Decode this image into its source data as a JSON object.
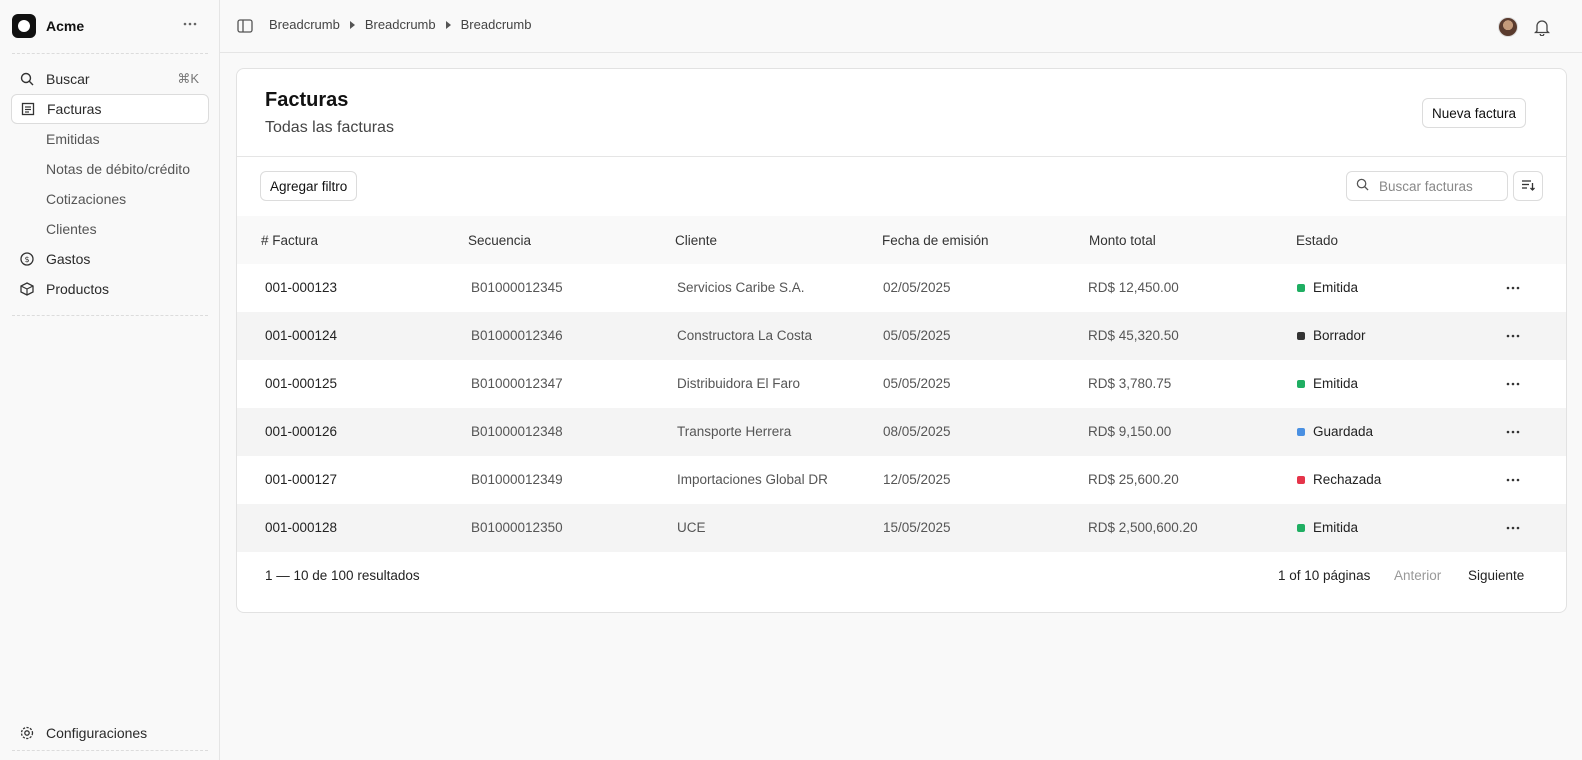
{
  "sidebar": {
    "brand": "Acme",
    "search": {
      "label": "Buscar",
      "shortcut": "⌘K"
    },
    "items": [
      {
        "label": "Facturas",
        "active": true
      },
      {
        "label": "Gastos"
      },
      {
        "label": "Productos"
      }
    ],
    "subitems": [
      "Emitidas",
      "Notas de débito/crédito",
      "Cotizaciones",
      "Clientes"
    ],
    "settings": "Configuraciones"
  },
  "topbar": {
    "breadcrumbs": [
      "Breadcrumb",
      "Breadcrumb",
      "Breadcrumb"
    ]
  },
  "page": {
    "title": "Facturas",
    "subtitle": "Todas las facturas",
    "new_button": "Nueva factura",
    "filter_button": "Agregar filtro",
    "search_placeholder": "Buscar facturas"
  },
  "table": {
    "columns": [
      "# Factura",
      "Secuencia",
      "Cliente",
      "Fecha de emisión",
      "Monto total",
      "Estado"
    ],
    "rows": [
      {
        "factura": "001-000123",
        "secuencia": "B01000012345",
        "cliente": "Servicios Caribe S.A.",
        "fecha": "02/05/2025",
        "monto": "RD$ 12,450.00",
        "estado": "Emitida",
        "color": "#1fae62"
      },
      {
        "factura": "001-000124",
        "secuencia": "B01000012346",
        "cliente": "Constructora La Costa",
        "fecha": "05/05/2025",
        "monto": "RD$ 45,320.50",
        "estado": "Borrador",
        "color": "#333333"
      },
      {
        "factura": "001-000125",
        "secuencia": "B01000012347",
        "cliente": "Distribuidora El Faro",
        "fecha": "05/05/2025",
        "monto": "RD$ 3,780.75",
        "estado": "Emitida",
        "color": "#1fae62"
      },
      {
        "factura": "001-000126",
        "secuencia": "B01000012348",
        "cliente": "Transporte Herrera",
        "fecha": "08/05/2025",
        "monto": "RD$ 9,150.00",
        "estado": "Guardada",
        "color": "#4a90e2"
      },
      {
        "factura": "001-000127",
        "secuencia": "B01000012349",
        "cliente": "Importaciones Global DR",
        "fecha": "12/05/2025",
        "monto": "RD$ 25,600.20",
        "estado": "Rechazada",
        "color": "#e5344a"
      },
      {
        "factura": "001-000128",
        "secuencia": "B01000012350",
        "cliente": "UCE",
        "fecha": "15/05/2025",
        "monto": "RD$ 2,500,600.20",
        "estado": "Emitida",
        "color": "#1fae62"
      }
    ]
  },
  "pagination": {
    "summary": "1 — 10 de 100 resultados",
    "pages": "1 of 10 páginas",
    "prev": "Anterior",
    "next": "Siguiente"
  }
}
